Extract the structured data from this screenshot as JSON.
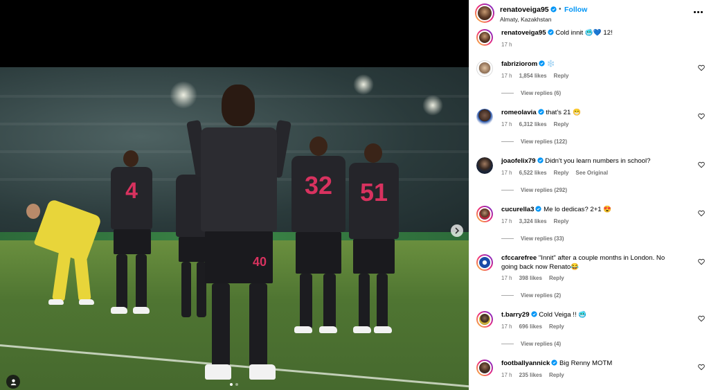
{
  "post": {
    "username": "renatoveiga95",
    "separator": "•",
    "follow_label": "Follow",
    "location": "Almaty, Kazakhstan"
  },
  "media": {
    "player_main_number": "40",
    "players": [
      "4",
      "32",
      "51"
    ],
    "carousel_dots": 2,
    "active_dot": 0
  },
  "comments": [
    {
      "user": "renatoveiga95",
      "text": "Cold innit 🥶💙 12!",
      "time": "17 h",
      "likes": "",
      "reply": "",
      "extra": "",
      "replies": ""
    },
    {
      "user": "fabriziorom",
      "text": "❄️",
      "time": "17 h",
      "likes": "1,854 likes",
      "reply": "Reply",
      "extra": "",
      "replies": "View replies (6)"
    },
    {
      "user": "romeolavia",
      "text": "that's 21 😁",
      "time": "17 h",
      "likes": "6,312 likes",
      "reply": "Reply",
      "extra": "",
      "replies": "View replies (122)"
    },
    {
      "user": "joaofelix79",
      "text": "Didn't you learn numbers in school?",
      "time": "17 h",
      "likes": "6,522 likes",
      "reply": "Reply",
      "extra": "See Original",
      "replies": "View replies (292)"
    },
    {
      "user": "cucurella3",
      "text": "Me lo dedicas? 2+1 😍",
      "time": "17 h",
      "likes": "3,324 likes",
      "reply": "Reply",
      "extra": "",
      "replies": "View replies (33)"
    },
    {
      "user": "cfccarefree",
      "text": "\"Innit\" after a couple months in London. No going back now Renato😂",
      "time": "17 h",
      "likes": "398 likes",
      "reply": "Reply",
      "extra": "",
      "replies": "View replies (2)"
    },
    {
      "user": "t.barry29",
      "text": "Cold Veiga !! 🥶",
      "time": "17 h",
      "likes": "696 likes",
      "reply": "Reply",
      "extra": "",
      "replies": "View replies (4)"
    },
    {
      "user": "footballyannick",
      "text": "Big Renny MOTM",
      "time": "17 h",
      "likes": "235 likes",
      "reply": "Reply",
      "extra": "",
      "replies": ""
    }
  ],
  "colors": {
    "accent": "#0095f6",
    "verified": "#0095f6",
    "meta": "#737373",
    "kit_accent": "#d8325f"
  },
  "icons": {
    "more": "more-options-icon",
    "heart": "heart-outline-icon",
    "verified": "verified-badge-icon",
    "next": "chevron-right-icon",
    "tags": "user-tag-icon"
  }
}
